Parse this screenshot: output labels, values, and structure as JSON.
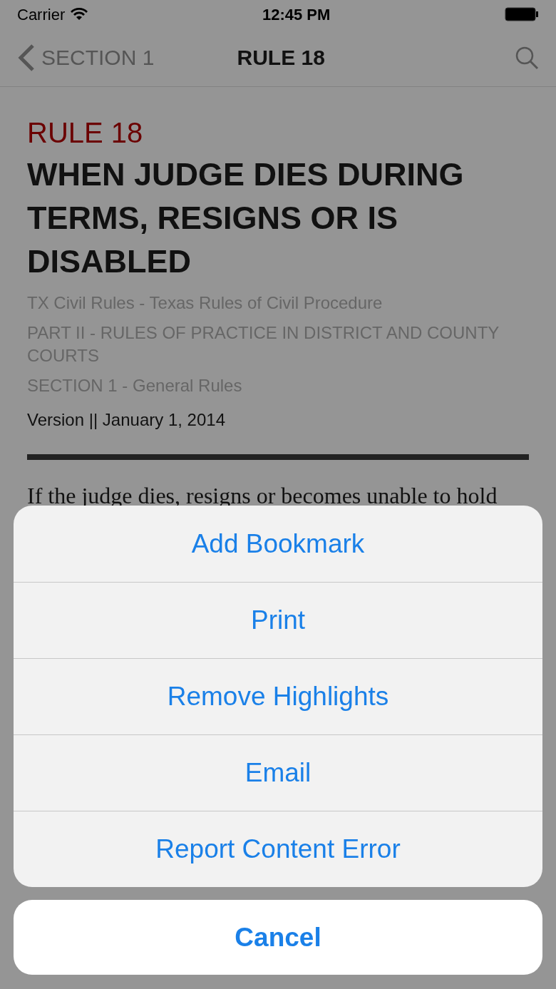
{
  "status_bar": {
    "carrier": "Carrier",
    "time": "12:45 PM"
  },
  "nav": {
    "back": "SECTION 1",
    "title": "RULE 18"
  },
  "rule": {
    "number": "RULE 18",
    "title": "WHEN JUDGE DIES DURING TERMS, RESIGNS OR IS DISABLED",
    "breadcrumbs": [
      "TX Civil Rules - Texas Rules of Civil Procedure",
      "PART II - RULES OF PRACTICE IN DISTRICT AND COUNTY COURTS",
      "SECTION 1 - General Rules"
    ],
    "version": "Version || January 1, 2014",
    "body": "If the judge dies, resigns or becomes unable to hold"
  },
  "action_sheet": {
    "actions": [
      "Add Bookmark",
      "Print",
      "Remove Highlights",
      "Email",
      "Report Content Error"
    ],
    "cancel": "Cancel"
  }
}
